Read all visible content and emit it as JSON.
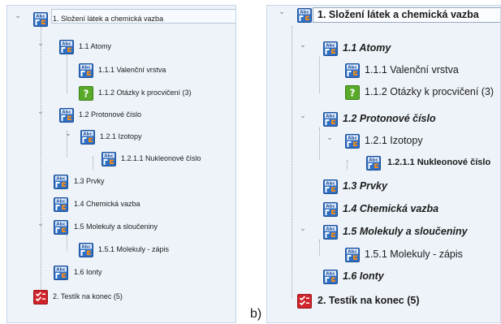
{
  "panel_a": {
    "items": [
      {
        "label": "1. Složení látek a chemická vazba",
        "icon": "abc-lesson-icon"
      },
      {
        "label": "1.1 Atomy",
        "icon": "abc-lesson-icon"
      },
      {
        "label": "1.1.1 Valenční vrstva",
        "icon": "abc-lesson-icon"
      },
      {
        "label": "1.1.2 Otázky k procvičení (3)",
        "icon": "question-icon"
      },
      {
        "label": "1.2 Protonové číslo",
        "icon": "abc-lesson-icon"
      },
      {
        "label": "1.2.1 Izotopy",
        "icon": "abc-lesson-icon"
      },
      {
        "label": "1.2.1.1 Nukleonové číslo",
        "icon": "abc-lesson-icon"
      },
      {
        "label": "1.3 Prvky",
        "icon": "abc-lesson-icon"
      },
      {
        "label": "1.4 Chemická vazba",
        "icon": "abc-lesson-icon"
      },
      {
        "label": "1.5 Molekuly a sloučeniny",
        "icon": "abc-lesson-icon"
      },
      {
        "label": "1.5.1 Molekuly - zápis",
        "icon": "abc-lesson-icon"
      },
      {
        "label": "1.6 Ionty",
        "icon": "abc-lesson-icon"
      },
      {
        "label": "2. Testík na konec (5)",
        "icon": "test-check-icon"
      }
    ]
  },
  "panel_b": {
    "caption": "b)",
    "items": [
      {
        "label": "1. Složení látek a chemická vazba",
        "icon": "abc-lesson-icon"
      },
      {
        "label": "1.1 Atomy",
        "icon": "abc-lesson-icon"
      },
      {
        "label": "1.1.1 Valenční vrstva",
        "icon": "abc-lesson-icon"
      },
      {
        "label": "1.1.2 Otázky k procvičení (3)",
        "icon": "question-icon"
      },
      {
        "label": "1.2 Protonové číslo",
        "icon": "abc-lesson-icon"
      },
      {
        "label": "1.2.1 Izotopy",
        "icon": "abc-lesson-icon"
      },
      {
        "label": "1.2.1.1 Nukleonové číslo",
        "icon": "abc-lesson-icon"
      },
      {
        "label": "1.3 Prvky",
        "icon": "abc-lesson-icon"
      },
      {
        "label": "1.4 Chemická vazba",
        "icon": "abc-lesson-icon"
      },
      {
        "label": "1.5 Molekuly a sloučeniny",
        "icon": "abc-lesson-icon"
      },
      {
        "label": "1.5.1 Molekuly - zápis",
        "icon": "abc-lesson-icon"
      },
      {
        "label": "1.6 Ionty",
        "icon": "abc-lesson-icon"
      },
      {
        "label": "2. Testík na konec (5)",
        "icon": "test-check-icon"
      }
    ]
  },
  "colors": {
    "panel_bg": "#eef3fa",
    "abc_blue": "#2e6fc4",
    "question_green": "#5aaa2a",
    "test_red": "#d0232c"
  }
}
